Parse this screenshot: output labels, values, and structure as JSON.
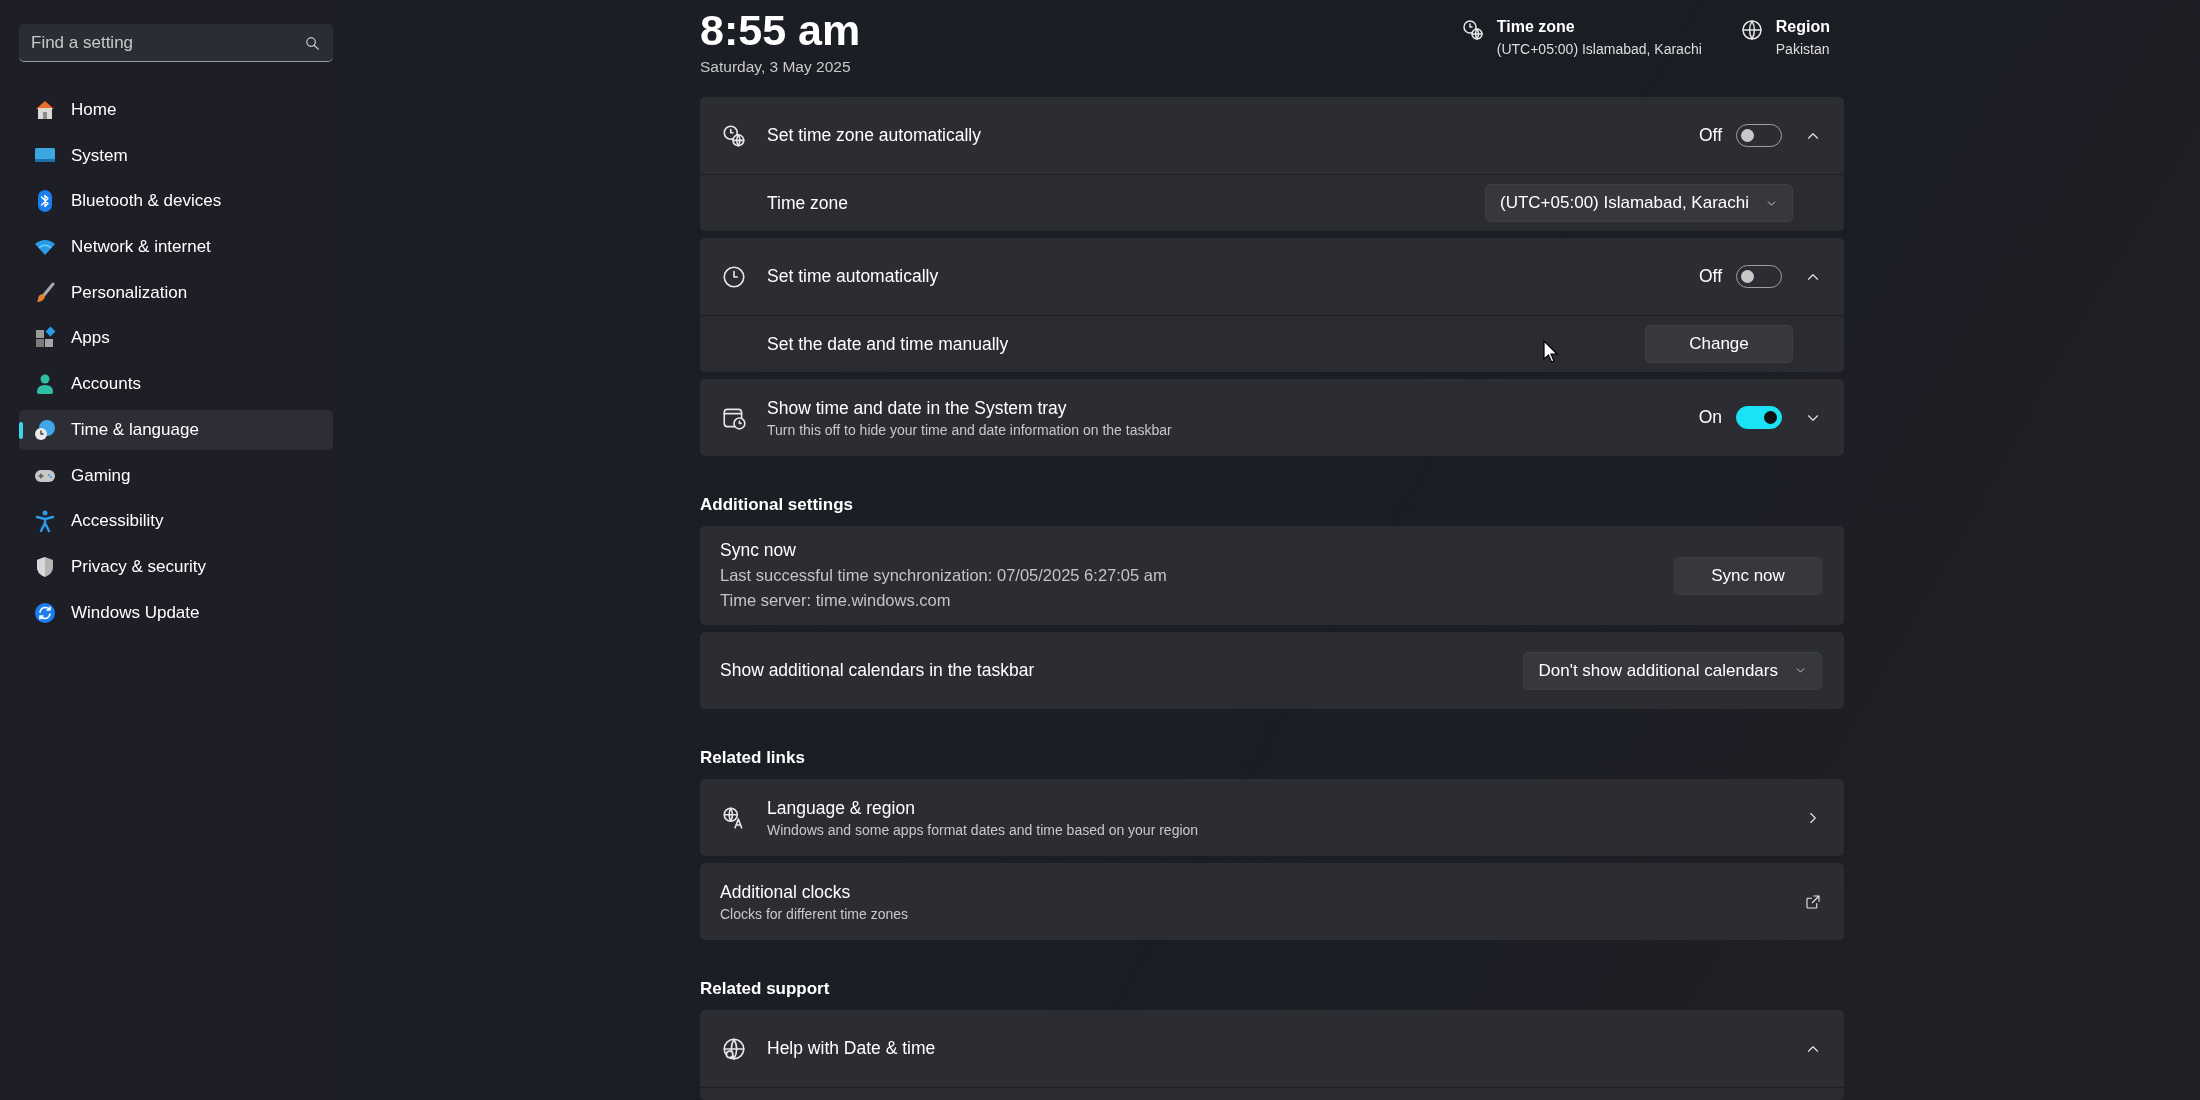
{
  "search": {
    "placeholder": "Find a setting"
  },
  "sidebar": {
    "items": [
      {
        "label": "Home",
        "selected": false
      },
      {
        "label": "System",
        "selected": false
      },
      {
        "label": "Bluetooth & devices",
        "selected": false
      },
      {
        "label": "Network & internet",
        "selected": false
      },
      {
        "label": "Personalization",
        "selected": false
      },
      {
        "label": "Apps",
        "selected": false
      },
      {
        "label": "Accounts",
        "selected": false
      },
      {
        "label": "Time & language",
        "selected": true
      },
      {
        "label": "Gaming",
        "selected": false
      },
      {
        "label": "Accessibility",
        "selected": false
      },
      {
        "label": "Privacy & security",
        "selected": false
      },
      {
        "label": "Windows Update",
        "selected": false
      }
    ]
  },
  "header": {
    "time": "8:55 am",
    "date": "Saturday, 3 May 2025",
    "info": [
      {
        "title": "Time zone",
        "value": "(UTC+05:00) Islamabad, Karachi"
      },
      {
        "title": "Region",
        "value": "Pakistan"
      }
    ]
  },
  "sections": [
    {
      "cards": [
        {
          "kind": "expander",
          "title": "Set time zone automatically",
          "toggle": {
            "label": "Off",
            "on": false
          },
          "expanded": true,
          "rows": [
            {
              "kind": "dropdown",
              "label": "Time zone",
              "value": "(UTC+05:00) Islamabad, Karachi"
            }
          ]
        },
        {
          "kind": "expander",
          "title": "Set time automatically",
          "toggle": {
            "label": "Off",
            "on": false
          },
          "expanded": true,
          "rows": [
            {
              "kind": "button",
              "label": "Set the date and time manually",
              "button": "Change"
            }
          ]
        },
        {
          "kind": "expander",
          "title": "Show time and date in the System tray",
          "subtitle": "Turn this off to hide your time and date information on the taskbar",
          "toggle": {
            "label": "On",
            "on": true
          },
          "expanded": false
        }
      ]
    },
    {
      "heading": "Additional settings",
      "cards": [
        {
          "kind": "button",
          "title": "Sync now",
          "lines": [
            "Last successful time synchronization: 07/05/2025 6:27:05 am",
            "Time server: time.windows.com"
          ],
          "button": "Sync now"
        },
        {
          "kind": "dropdown",
          "title": "Show additional calendars in the taskbar",
          "value": "Don't show additional calendars"
        }
      ]
    },
    {
      "heading": "Related links",
      "cards": [
        {
          "kind": "link",
          "title": "Language & region",
          "subtitle": "Windows and some apps format dates and time based on your region",
          "external": false
        },
        {
          "kind": "link",
          "title": "Additional clocks",
          "subtitle": "Clocks for different time zones",
          "external": true
        }
      ]
    },
    {
      "heading": "Related support",
      "cards": [
        {
          "kind": "expander",
          "title": "Help with Date & time",
          "expanded": true
        }
      ]
    }
  ]
}
